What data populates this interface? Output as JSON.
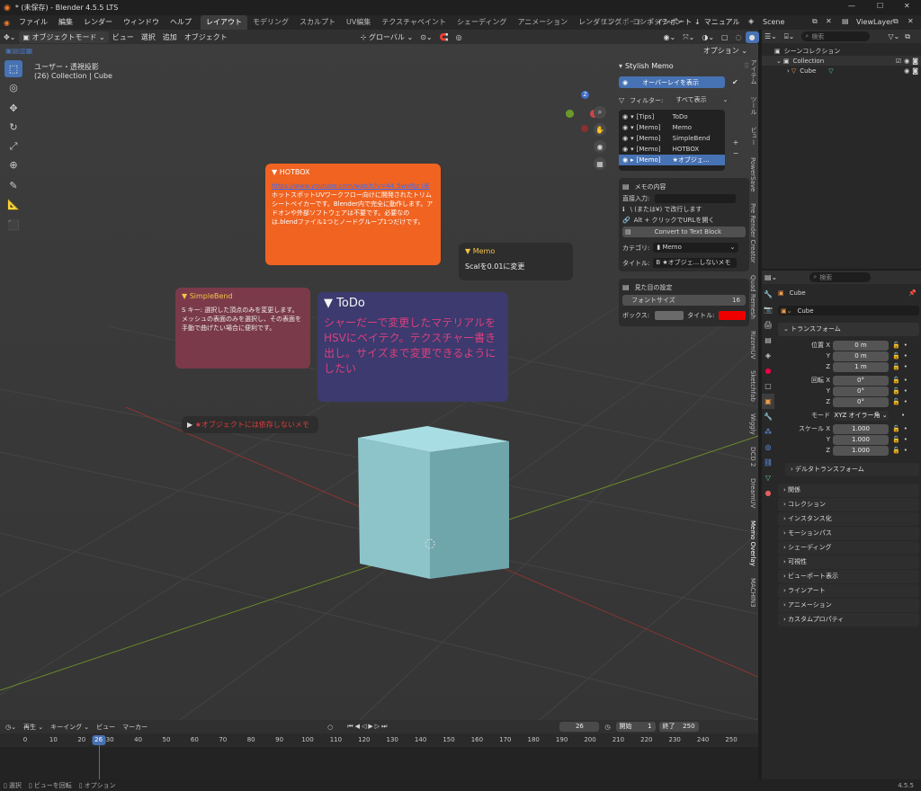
{
  "window": {
    "title": "* (未保存) - Blender 4.5.5 LTS"
  },
  "menubar": {
    "items": [
      "ファイル",
      "編集",
      "レンダー",
      "ウィンドウ",
      "ヘルプ"
    ],
    "workspaces": [
      "レイアウト",
      "モデリング",
      "スカルプト",
      "UV編集",
      "テクスチャペイント",
      "シェーディング",
      "アニメーション",
      "レンダリング",
      "コンポジティン"
    ],
    "active_workspace": "レイアウト",
    "export_label": "エクスポート",
    "import_label": "インポート",
    "manual_label": "マニュアル",
    "scene": "Scene",
    "viewlayer": "ViewLayer"
  },
  "viewport_header": {
    "mode": "オブジェクトモード",
    "menus": [
      "ビュー",
      "選択",
      "追加",
      "オブジェクト"
    ],
    "transform_orientation": "グローバル",
    "options": "オプション"
  },
  "viewport": {
    "view_name": "ユーザー・透視投影",
    "collection_info": "(26) Collection | Cube"
  },
  "memos": {
    "hotbox": {
      "title": "HOTBOX",
      "link": "https://www.youtube.com/watch?v=44_5wv9Jz UE",
      "body": "ホットスポットUVワークフロー向けに開発されたトリムシートベイカーです。Blender内で完全に動作します。アドオンや外部ソフトウェアは不要です。必要なのは.blendファイル1つとノードグループ1つだけです。",
      "color": "#f06320"
    },
    "memo": {
      "title": "Memo",
      "body": "Scalを0.01に変更"
    },
    "simplebend": {
      "title": "SimpleBend",
      "body": "S キー: 選択した頂点のみを変更します。メッシュの表面のみを選択し、その表面を手動で曲げたい場合に便利です。",
      "color": "#7a3a4a"
    },
    "todo": {
      "title": "ToDo",
      "body": "シャーだーで変更したマテリアルをHSVにベイテク。テクスチャー書き出し。サイズまで変更できるようにしたい",
      "color": "#3c3a6e",
      "text_color": "#d9407e"
    },
    "collapsed": {
      "label": "★オブジェクトには依存しないメモ",
      "color": "#e33b3b"
    }
  },
  "npanel": {
    "title": "Stylish Memo",
    "overlay_button": "オーバーレイを表示",
    "filter_label": "フィルター:",
    "filter_value": "すべて表示",
    "list": [
      {
        "type": "[Tips]",
        "name": "ToDo"
      },
      {
        "type": "[Memo]",
        "name": "Memo"
      },
      {
        "type": "[Memo]",
        "name": "SimpleBend"
      },
      {
        "type": "[Memo]",
        "name": "HOTBOX"
      },
      {
        "type": "[Memo]",
        "name": "★オブジェ..."
      }
    ],
    "content_title": "メモの内容",
    "direct_input_label": "直接入力:",
    "hint1": "\\ (または¥) で改行します",
    "hint2": "Alt + クリックでURLを開く",
    "convert_button": "Convert to Text Block",
    "category_label": "カテゴリ:",
    "category_value": "Memo",
    "title_label": "タイトル:",
    "title_value": "★オブジェ...しないメモ",
    "appearance_title": "見た目の設定",
    "font_size_label": "フォントサイズ",
    "font_size_value": "16",
    "box_label": "ボックス:",
    "title_color_label": "タイトル:"
  },
  "sidetabs": [
    "アイテム",
    "ツール",
    "ビュー",
    "PowerSave",
    "Pre Render Creator",
    "Quad Remesh",
    "RizomUV",
    "Sketchfab",
    "Wiggly",
    "DCD 2",
    "DreamUV",
    "Memo Overlay",
    "MACHIN3"
  ],
  "outliner": {
    "search_placeholder": "検索",
    "root": "シーンコレクション",
    "collection": "Collection",
    "object": "Cube"
  },
  "properties": {
    "search_placeholder": "検索",
    "object_name": "Cube",
    "object_field": "Cube",
    "transform_title": "トランスフォーム",
    "location": {
      "label": "位置 X",
      "x": "0 m",
      "y": "0 m",
      "z": "1 m"
    },
    "rotation": {
      "label": "回転 X",
      "x": "0°",
      "y": "0°",
      "z": "0°"
    },
    "mode_label": "モード",
    "mode_value": "XYZ オイラー角",
    "scale": {
      "label": "スケール X",
      "x": "1.000",
      "y": "1.000",
      "z": "1.000"
    },
    "y_label": "Y",
    "z_label": "Z",
    "delta": "デルタトランスフォーム",
    "sections": [
      "関係",
      "コレクション",
      "インスタンス化",
      "モーションパス",
      "シェーディング",
      "可視性",
      "ビューポート表示",
      "ラインアート",
      "アニメーション",
      "カスタムプロパティ"
    ]
  },
  "timeline": {
    "menus": [
      "再生",
      "キーイング",
      "ビュー",
      "マーカー"
    ],
    "current_frame": "26",
    "start_label": "開始",
    "start": "1",
    "end_label": "終了",
    "end": "250",
    "ticks": [
      "0",
      "10",
      "20",
      "30",
      "40",
      "50",
      "60",
      "70",
      "80",
      "90",
      "100",
      "110",
      "120",
      "130",
      "140",
      "150",
      "160",
      "170",
      "180",
      "190",
      "200",
      "210",
      "220",
      "230",
      "240",
      "250"
    ]
  },
  "statusbar": {
    "select": "選択",
    "rotate": "ビューを回転",
    "options": "オプション",
    "version": "4.5.5"
  }
}
